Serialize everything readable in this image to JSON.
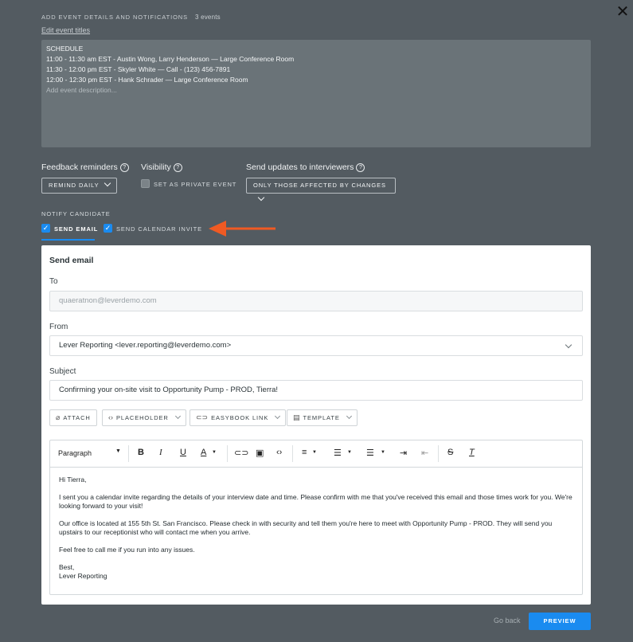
{
  "header": {
    "label": "ADD EVENT DETAILS AND NOTIFICATIONS",
    "count": "3 events",
    "edit_link": "Edit event titles",
    "close_symbol": "✕"
  },
  "description": {
    "lines": [
      "SCHEDULE",
      "11:00 - 11:30 am EST - Austin Wong,  Larry Henderson — Large Conference Room",
      "11:30 - 12:00 pm EST - Skyler White — Call - (123) 456-7891",
      "12:00 - 12:30 pm EST - Hank Schrader — Large Conference Room"
    ],
    "placeholder": "Add event description..."
  },
  "options": {
    "feedback_label": "Feedback reminders",
    "feedback_value": "REMIND DAILY",
    "visibility_label": "Visibility",
    "private_label": "SET AS PRIVATE EVENT",
    "updates_label": "Send updates to interviewers",
    "updates_value": "ONLY THOSE AFFECTED BY CHANGES",
    "help_symbol": "?"
  },
  "notify": {
    "label": "NOTIFY CANDIDATE",
    "send_email": "SEND EMAIL",
    "send_calendar": "SEND CALENDAR INVITE",
    "check_symbol": "✓"
  },
  "email": {
    "title": "Send email",
    "to_label": "To",
    "to_value": "quaeratnon@leverdemo.com",
    "from_label": "From",
    "from_value": "Lever Reporting <lever.reporting@leverdemo.com>",
    "subject_label": "Subject",
    "subject_value": "Confirming your on-site visit to Opportunity Pump - PROD, Tierra!",
    "tools": {
      "attach": "ATTACH",
      "placeholder": "PLACEHOLDER",
      "easybook": "EASYBOOK LINK",
      "template": "TEMPLATE"
    },
    "editor": {
      "paragraph": "Paragraph",
      "body": [
        "Hi Tierra,",
        "I sent you a calendar invite regarding the details of your interview date and time. Please confirm with me that you've received this email and those times work for you. We're looking forward to your visit!",
        "Our office is located at 155 5th St. San Francisco. Please check in with security and tell them you're here to meet with Opportunity Pump - PROD. They will send you upstairs to our receptionist who will contact me when you arrive.",
        "Feel free to call me if you run into any issues.",
        "Best,",
        "Lever Reporting"
      ]
    }
  },
  "footer": {
    "go_back": "Go back",
    "preview": "PREVIEW"
  },
  "colors": {
    "accent": "#1a8bf0",
    "arrow": "#ef5a23",
    "backdrop": "#535b61"
  }
}
